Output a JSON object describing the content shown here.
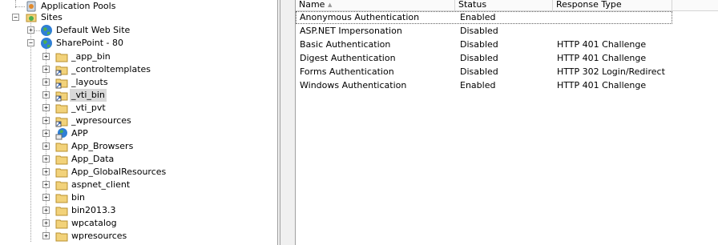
{
  "tree": {
    "items": [
      {
        "label": "Application Pools",
        "icon": "app-pools-icon"
      },
      {
        "label": "Sites",
        "icon": "sites-folder-icon",
        "expander": "−"
      },
      {
        "label": "Default Web Site",
        "icon": "globe-icon",
        "expander": "+"
      },
      {
        "label": "SharePoint - 80",
        "icon": "globe-icon",
        "expander": "−"
      },
      {
        "label": "_app_bin",
        "icon": "folder-icon",
        "expander": "+"
      },
      {
        "label": "_controltemplates",
        "icon": "virtual-directory-icon",
        "expander": "+"
      },
      {
        "label": "_layouts",
        "icon": "virtual-directory-icon",
        "expander": "+"
      },
      {
        "label": "_vti_bin",
        "icon": "virtual-directory-icon",
        "expander": "+",
        "selected": true
      },
      {
        "label": "_vti_pvt",
        "icon": "folder-icon",
        "expander": "+"
      },
      {
        "label": "_wpresources",
        "icon": "virtual-directory-icon",
        "expander": "+"
      },
      {
        "label": "APP",
        "icon": "application-globe-icon",
        "expander": "+"
      },
      {
        "label": "App_Browsers",
        "icon": "folder-icon",
        "expander": "+"
      },
      {
        "label": "App_Data",
        "icon": "folder-icon",
        "expander": "+"
      },
      {
        "label": "App_GlobalResources",
        "icon": "folder-icon",
        "expander": "+"
      },
      {
        "label": "aspnet_client",
        "icon": "folder-icon",
        "expander": "+"
      },
      {
        "label": "bin",
        "icon": "folder-icon",
        "expander": "+"
      },
      {
        "label": "bin2013.3",
        "icon": "folder-icon",
        "expander": "+"
      },
      {
        "label": "wpcatalog",
        "icon": "folder-icon",
        "expander": "+"
      },
      {
        "label": "wpresources",
        "icon": "folder-icon",
        "expander": "+"
      }
    ]
  },
  "list": {
    "columns": [
      "Name",
      "Status",
      "Response Type"
    ],
    "sort_indicator": "▲",
    "rows": [
      {
        "name": "Anonymous Authentication",
        "status": "Enabled",
        "response": ""
      },
      {
        "name": "ASP.NET Impersonation",
        "status": "Disabled",
        "response": ""
      },
      {
        "name": "Basic Authentication",
        "status": "Disabled",
        "response": "HTTP 401 Challenge"
      },
      {
        "name": "Digest Authentication",
        "status": "Disabled",
        "response": "HTTP 401 Challenge"
      },
      {
        "name": "Forms Authentication",
        "status": "Disabled",
        "response": "HTTP 302 Login/Redirect"
      },
      {
        "name": "Windows Authentication",
        "status": "Enabled",
        "response": "HTTP 401 Challenge"
      }
    ]
  },
  "colors": {
    "selection": "#d9d9d9",
    "folder": "#f2d27a",
    "globe_blue": "#2f7fd6",
    "globe_green": "#4caf50"
  }
}
